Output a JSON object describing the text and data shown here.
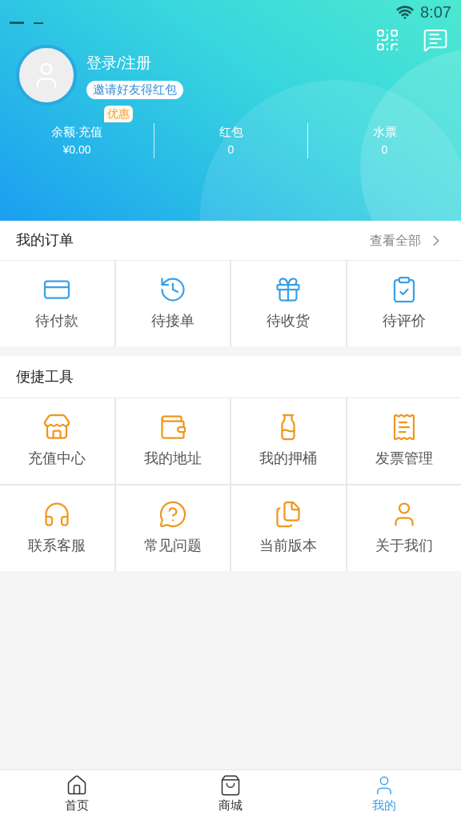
{
  "status_bar": {
    "time": "8:07"
  },
  "profile": {
    "login": "登录/注册",
    "invite": "邀请好友得红包"
  },
  "stats": [
    {
      "label": "余额·充值",
      "value": "¥0.00",
      "badge": "优惠"
    },
    {
      "label": "红包",
      "value": "0"
    },
    {
      "label": "水票",
      "value": "0"
    }
  ],
  "orders": {
    "title": "我的订单",
    "view_all": "查看全部",
    "items": [
      "待付款",
      "待接单",
      "待收货",
      "待评价"
    ]
  },
  "tools": {
    "title": "便捷工具",
    "items": [
      "充值中心",
      "我的地址",
      "我的押桶",
      "发票管理",
      "联系客服",
      "常见问题",
      "当前版本",
      "关于我们"
    ]
  },
  "tab_bar": [
    {
      "label": "首页",
      "selected": false
    },
    {
      "label": "商城",
      "selected": false
    },
    {
      "label": "我的",
      "selected": true
    }
  ]
}
